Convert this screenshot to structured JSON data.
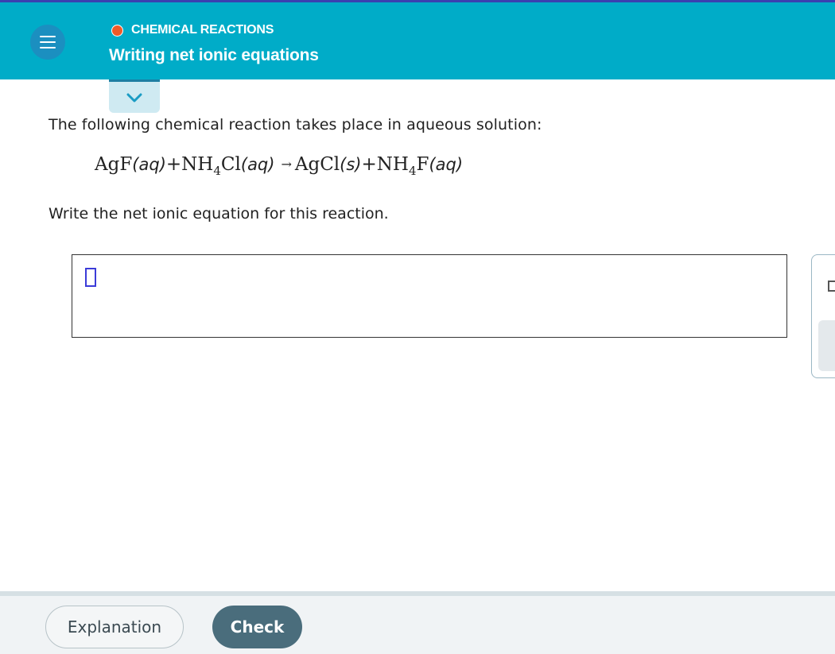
{
  "header": {
    "topic": "CHEMICAL REACTIONS",
    "title": "Writing net ionic equations",
    "menu_icon": "hamburger-icon",
    "topic_dot_color": "#f05a28"
  },
  "question": {
    "prompt": "The following chemical reaction takes place in aqueous solution:",
    "equation": {
      "r1": "AgF",
      "r1_state": "(aq)",
      "plus1": "+",
      "r2_a": "NH",
      "r2_sub": "4",
      "r2_b": "Cl",
      "r2_state": "(aq)",
      "arrow": "→",
      "p1": "AgCl",
      "p1_state": "(s)",
      "plus2": "+",
      "p2_a": "NH",
      "p2_sub": "4",
      "p2_b": "F",
      "p2_state": "(aq)"
    },
    "instruction": "Write the net ionic equation for this reaction."
  },
  "footer": {
    "explanation_label": "Explanation",
    "check_label": "Check"
  },
  "colors": {
    "header_bg": "#00acc8",
    "check_bg": "#4a6d7c"
  }
}
